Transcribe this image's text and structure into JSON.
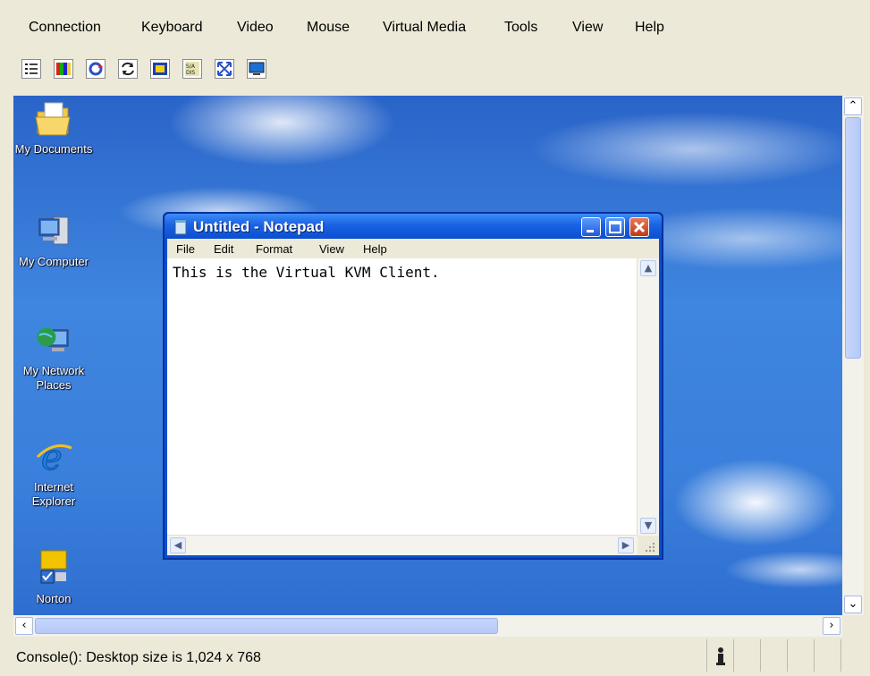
{
  "menubar": {
    "items": [
      "Connection",
      "Keyboard",
      "Video",
      "Mouse",
      "Virtual Media",
      "Tools",
      "View",
      "Help"
    ]
  },
  "toolbar": {
    "buttons": [
      "settings-icon",
      "color-bars-icon",
      "refresh-icon",
      "sync-icon",
      "video-icon",
      "single-cursor-icon",
      "fullscreen-icon",
      "screen-icon"
    ]
  },
  "desktop": {
    "icons": [
      {
        "name": "My Documents"
      },
      {
        "name": "My Computer"
      },
      {
        "name": "My Network Places"
      },
      {
        "name": "Internet Explorer"
      },
      {
        "name": "Norton"
      }
    ]
  },
  "notepad": {
    "title": "Untitled - Notepad",
    "menu": [
      "File",
      "Edit",
      "Format",
      "View",
      "Help"
    ],
    "content": "This is the Virtual KVM Client."
  },
  "status": {
    "text": "Console(): Desktop size is 1,024 x 768"
  },
  "colors": {
    "desktop_blue": "#3a7fdb",
    "titlebar_blue": "#0a4fcf",
    "chrome": "#ece9d8"
  }
}
